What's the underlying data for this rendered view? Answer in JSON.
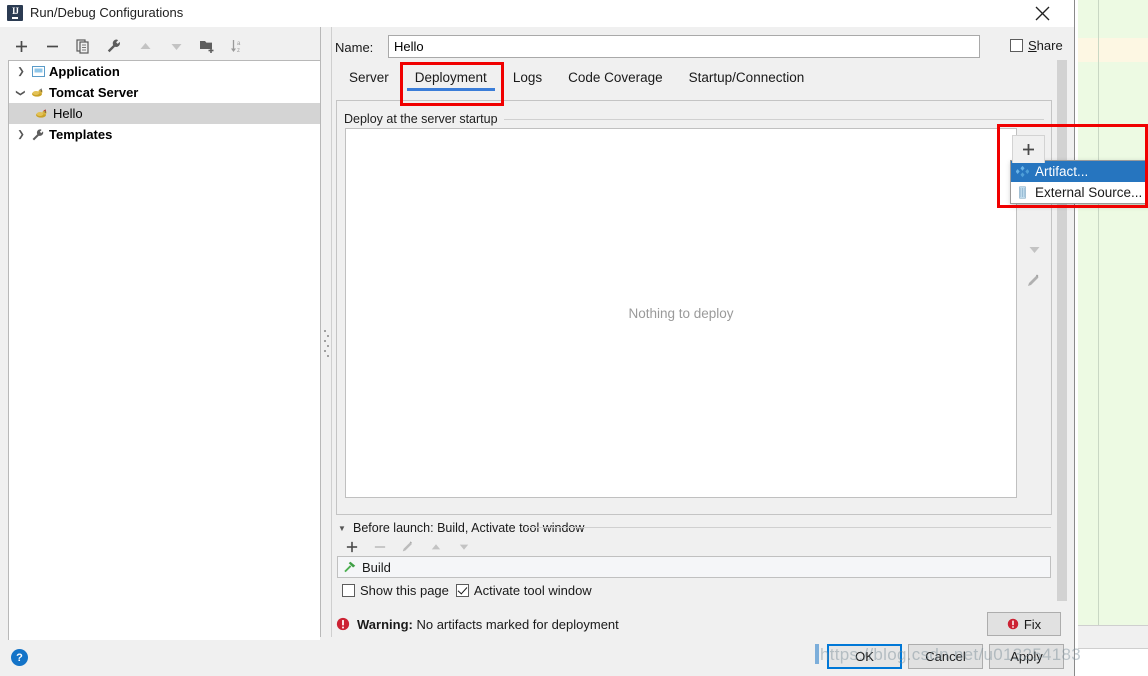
{
  "window": {
    "title": "Run/Debug Configurations",
    "app_icon": "intellij-idea-icon",
    "close_label": "✕"
  },
  "tree_toolbar": {
    "buttons": [
      {
        "name": "add-configuration-button",
        "icon": "plus-icon",
        "label": "+"
      },
      {
        "name": "remove-configuration-button",
        "icon": "minus-icon",
        "label": "−"
      },
      {
        "name": "copy-configuration-button",
        "icon": "copy-icon",
        "label": ""
      },
      {
        "name": "edit-templates-button",
        "icon": "wrench-icon",
        "label": ""
      },
      {
        "name": "move-up-button",
        "icon": "arrow-up-icon",
        "label": "▲"
      },
      {
        "name": "move-down-button",
        "icon": "arrow-down-icon",
        "label": "▼"
      },
      {
        "name": "move-into-folder-button",
        "icon": "new-folder-icon",
        "label": ""
      },
      {
        "name": "sort-configurations-button",
        "icon": "sort-az-icon",
        "label": ""
      }
    ]
  },
  "tree": {
    "items": [
      {
        "label": "Application",
        "icon": "application-icon",
        "expander": "collapsed",
        "indent": 0,
        "selected": false,
        "bold": true
      },
      {
        "label": "Tomcat Server",
        "icon": "tomcat-icon",
        "expander": "expanded",
        "indent": 0,
        "selected": false,
        "bold": true
      },
      {
        "label": "Hello",
        "icon": "tomcat-icon",
        "expander": "none",
        "indent": 1,
        "selected": true,
        "bold": false
      },
      {
        "label": "Templates",
        "icon": "wrench-icon",
        "expander": "collapsed",
        "indent": 0,
        "selected": false,
        "bold": true
      }
    ]
  },
  "name_row": {
    "label": "Name:",
    "value": "Hello",
    "placeholder": "",
    "share_label": "Share",
    "share_mnemonic": "S",
    "share_checked": false
  },
  "tabs": [
    {
      "label": "Server",
      "active": false
    },
    {
      "label": "Deployment",
      "active": true,
      "highlighted": true
    },
    {
      "label": "Logs",
      "active": false
    },
    {
      "label": "Code Coverage",
      "active": false
    },
    {
      "label": "Startup/Connection",
      "active": false
    }
  ],
  "deployment": {
    "legend": "Deploy at the server startup",
    "empty_text": "Nothing to deploy",
    "sidebar_buttons": [
      {
        "name": "add-deployment-button",
        "icon": "plus-icon",
        "label": "+"
      },
      {
        "name": "remove-deployment-button",
        "icon": "minus-icon",
        "label": "−"
      },
      {
        "name": "move-down-deployment-button",
        "icon": "arrow-down-icon",
        "label": "▼"
      },
      {
        "name": "edit-deployment-button",
        "icon": "pencil-icon",
        "label": ""
      }
    ]
  },
  "popup_menu": {
    "trigger_label": "+",
    "items": [
      {
        "label": "Artifact...",
        "icon": "artifact-icon",
        "highlighted": true
      },
      {
        "label": "External Source...",
        "icon": "external-source-icon",
        "highlighted": false
      }
    ]
  },
  "before_launch": {
    "header": "Before launch: Build, Activate tool window",
    "toolbar": [
      {
        "name": "add-task-button",
        "icon": "plus-icon",
        "label": "+"
      },
      {
        "name": "remove-task-button",
        "icon": "minus-icon",
        "label": "−"
      },
      {
        "name": "edit-task-button",
        "icon": "pencil-icon",
        "label": ""
      },
      {
        "name": "task-move-up-button",
        "icon": "arrow-up-icon",
        "label": "▲"
      },
      {
        "name": "task-move-down-button",
        "icon": "arrow-down-icon",
        "label": "▼"
      }
    ],
    "task": {
      "label": "Build",
      "icon": "hammer-icon"
    },
    "checkboxes": [
      {
        "label": "Show this page",
        "checked": false
      },
      {
        "label": "Activate tool window",
        "checked": true
      }
    ]
  },
  "warning": {
    "prefix": "Warning:",
    "message": "No artifacts marked for deployment",
    "fix_label": "Fix",
    "icon": "warning-icon",
    "color": "#cc2233"
  },
  "footer": {
    "help_label": "?",
    "buttons": [
      {
        "name": "ok-button",
        "label": "OK",
        "primary": true
      },
      {
        "name": "cancel-button",
        "label": "Cancel",
        "primary": false
      },
      {
        "name": "apply-button",
        "label": "Apply",
        "primary": false
      }
    ]
  },
  "watermark": {
    "text": "https://blog.csdn.net/u013254183"
  },
  "colors": {
    "accent": "#3b7dd8",
    "selection": "#2675bf",
    "highlight_box": "#f00000",
    "warning": "#cc2233",
    "dialog_bg": "#f0f0f0",
    "editor_bg": "#edfae3"
  }
}
